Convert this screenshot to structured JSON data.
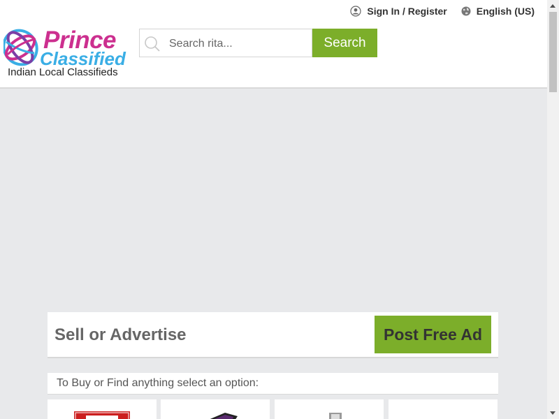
{
  "header": {
    "sign_in_label": "Sign In / Register",
    "language_label": "English (US)",
    "logo": {
      "line1": "Prince",
      "line2": "Classified",
      "tagline": "Indian Local Classifieds"
    },
    "search": {
      "placeholder": "Search rita...",
      "button_label": "Search"
    }
  },
  "sell": {
    "title": "Sell or Advertise",
    "button_label": "Post Free Ad"
  },
  "options": {
    "prompt": "To Buy or Find anything select an option:"
  },
  "colors": {
    "accent_green": "#7cae2a",
    "brand_pink": "#cc2f8f",
    "brand_blue": "#3aaee5",
    "page_bg": "#e8e9eb"
  }
}
